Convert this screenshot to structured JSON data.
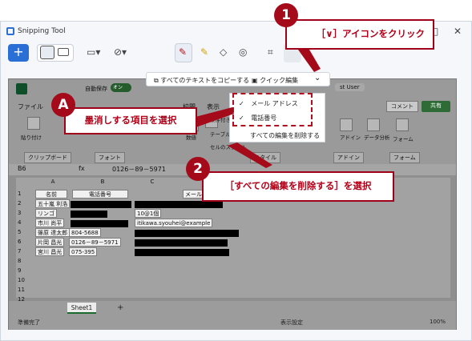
{
  "window": {
    "title": "Snipping Tool",
    "controls": {
      "minimize": "–",
      "maximize": "□",
      "close": "✕"
    }
  },
  "toolbar": {
    "new_label": "+",
    "icons": [
      "new-snip-icon",
      "camera-icon",
      "video-icon",
      "shape-icon",
      "timer-off-icon",
      "pen-icon",
      "highlighter-icon",
      "eraser-icon",
      "shapes-icon",
      "crop-icon",
      "text-actions-icon"
    ]
  },
  "popup": {
    "copy_all": "すべてのテキストをコピーする",
    "quick_redact": "クイック編集",
    "chevron": "⌄"
  },
  "dropdown": {
    "items": [
      {
        "check": "✓",
        "label": "メール アドレス"
      },
      {
        "check": "✓",
        "label": "電話番号"
      }
    ],
    "remove_all": "すべての編集を削除する"
  },
  "excel": {
    "autosave": "自動保存",
    "toggle": "オン",
    "user": "st User",
    "tabs": [
      "ファイル",
      "校閲",
      "表示"
    ],
    "comment": "コメント",
    "share": "共有",
    "groups": [
      "クリップボード",
      "フォント",
      "スタイル",
      "アドイン",
      "フォーム"
    ],
    "ribbon_labels": [
      "貼り付け",
      "条件付き書式",
      "テーブル",
      "セルのスタイル",
      "数値",
      "アドイン",
      "データ分析",
      "フォーム"
    ],
    "name_box": "B6",
    "fx": "fx",
    "formula": "0126－89－5971",
    "columns": [
      "A",
      "B",
      "C"
    ],
    "rows": [
      "1",
      "2",
      "3",
      "4",
      "5",
      "6",
      "7",
      "8",
      "9",
      "10",
      "11",
      "12",
      "13"
    ],
    "header_cells": [
      "名前",
      "電話番号",
      "メール"
    ],
    "names": [
      "五十嵐 利浩",
      "リンゴ",
      "市川 尚平",
      "篠原 達太郎",
      "片岡 昌光",
      "宮川 昌光"
    ],
    "phones": [
      "804-5688",
      "0126－89－5971",
      "075-395"
    ],
    "emails": [
      "10@1個",
      "itikawa.syouhei@example"
    ],
    "sheet": "Sheet1",
    "add_sheet": "+",
    "status_ready": "準備完了",
    "status_display": "表示設定",
    "zoom": "100%"
  },
  "annotations": {
    "step1_badge": "1",
    "step1_text": "［∨］アイコンをクリック",
    "stepA_badge": "A",
    "stepA_text": "墨消しする項目を選択",
    "step2_badge": "2",
    "step2_text": "［すべての編集を削除する］を選択"
  },
  "colors": {
    "accent": "#2a6fd6",
    "callout": "#a50a1a",
    "excel_green": "#1c6b2e"
  }
}
